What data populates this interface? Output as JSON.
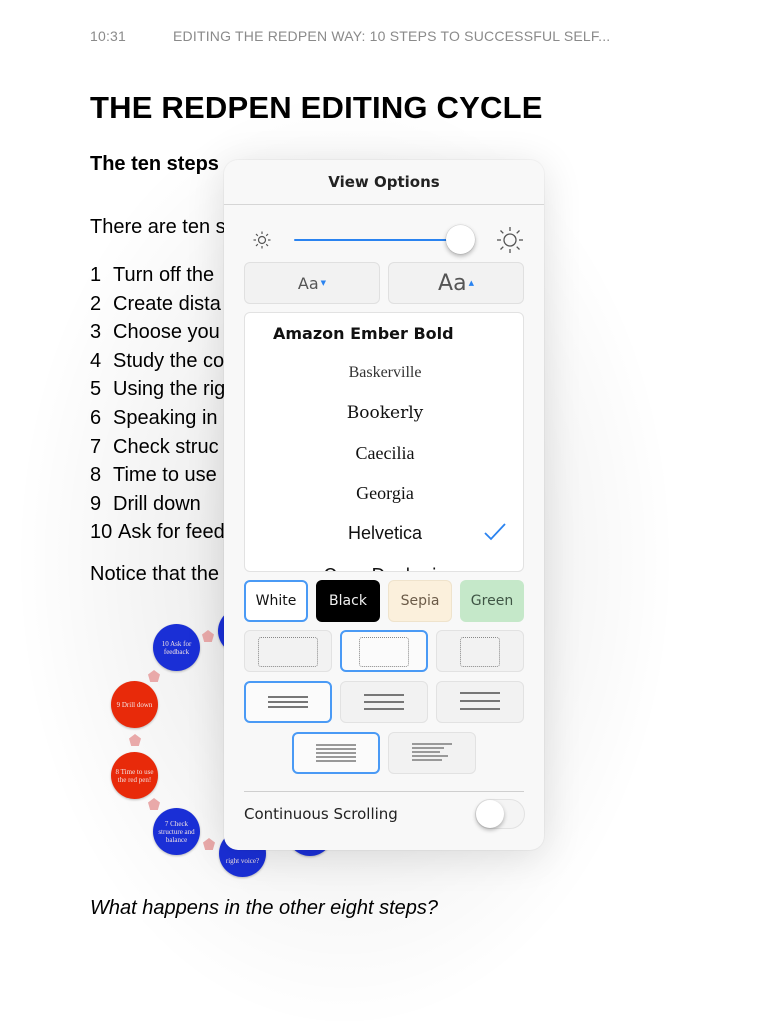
{
  "status": {
    "time": "10:31",
    "book_title": "EDITING THE REDPEN WAY: 10 STEPS TO SUCCESSFUL SELF..."
  },
  "book": {
    "chapter_title": "THE REDPEN EDITING CYCLE",
    "subhead": "The ten steps",
    "intro": "There are ten s",
    "steps": [
      {
        "num": "1",
        "text": "Turn off the"
      },
      {
        "num": "2",
        "text": "Create dista"
      },
      {
        "num": "3",
        "text": "Choose you"
      },
      {
        "num": "4",
        "text": "Study the co"
      },
      {
        "num": "5",
        "text": "Using the rig"
      },
      {
        "num": "6",
        "text": "Speaking in"
      },
      {
        "num": "7",
        "text": "Check struc"
      },
      {
        "num": "8",
        "text": "Time to use"
      },
      {
        "num": "9",
        "text": "Drill down"
      },
      {
        "num": "10",
        "text": "Ask for feed"
      }
    ],
    "notice": "Notice that the",
    "question": "What happens in the other eight steps?",
    "cycle_nodes": [
      {
        "label": "10 Ask for feedback",
        "color": "blue"
      },
      {
        "label": "9 Drill down",
        "color": "red"
      },
      {
        "label": "8 Time to use the red pen!",
        "color": "red"
      },
      {
        "label": "7 Check structure and balance",
        "color": "blue"
      },
      {
        "label": "right voice?",
        "color": "blue"
      }
    ]
  },
  "view_options": {
    "title": "View Options",
    "brightness": 0.92,
    "font_size_decrease_label": "Aa",
    "font_size_increase_label": "Aa",
    "fonts": [
      {
        "name": "Amazon Ember Bold",
        "selected": false
      },
      {
        "name": "Baskerville",
        "selected": false
      },
      {
        "name": "Bookerly",
        "selected": false
      },
      {
        "name": "Caecilia",
        "selected": false
      },
      {
        "name": "Georgia",
        "selected": false
      },
      {
        "name": "Helvetica",
        "selected": true
      },
      {
        "name": "OpenDyslexic",
        "selected": false
      }
    ],
    "themes": [
      {
        "label": "White",
        "selected": true,
        "color": "#ffffff"
      },
      {
        "label": "Black",
        "selected": false,
        "color": "#000000"
      },
      {
        "label": "Sepia",
        "selected": false,
        "color": "#fbf0dc"
      },
      {
        "label": "Green",
        "selected": false,
        "color": "#c5e8c9"
      }
    ],
    "margins": [
      "narrow",
      "normal",
      "wide"
    ],
    "margins_selected": "normal",
    "line_spacing": [
      "small",
      "medium",
      "large"
    ],
    "line_spacing_selected": "small",
    "alignment": [
      "justified",
      "left"
    ],
    "alignment_selected": "justified",
    "continuous_scrolling_label": "Continuous Scrolling",
    "continuous_scrolling": false,
    "accent_color": "#2a83f0"
  }
}
